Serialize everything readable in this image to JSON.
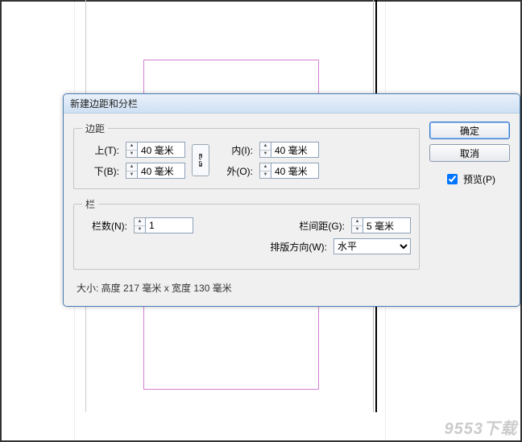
{
  "dialog": {
    "title": "新建边距和分栏",
    "margins": {
      "legend": "边距",
      "top_label": "上(T):",
      "top_value": "40 毫米",
      "bottom_label": "下(B):",
      "bottom_value": "40 毫米",
      "inside_label": "内(I):",
      "inside_value": "40 毫米",
      "outside_label": "外(O):",
      "outside_value": "40 毫米"
    },
    "columns": {
      "legend": "栏",
      "count_label": "栏数(N):",
      "count_value": "1",
      "gutter_label": "栏间距(G):",
      "gutter_value": "5 毫米",
      "direction_label": "排版方向(W):",
      "direction_value": "水平"
    },
    "size_line": "大小: 高度 217 毫米 x 宽度 130 毫米",
    "buttons": {
      "ok": "确定",
      "cancel": "取消",
      "preview": "预览(P)"
    }
  },
  "watermark": "9553下载"
}
